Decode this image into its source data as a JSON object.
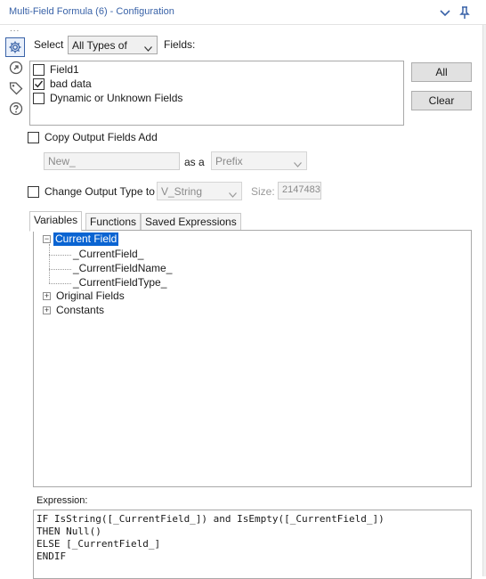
{
  "window": {
    "title": "Multi-Field Formula (6) - Configuration"
  },
  "select_row": {
    "select_label": "Select",
    "type_dropdown_value": "All Types of",
    "fields_label": "Fields:"
  },
  "fields": [
    {
      "label": "Field1",
      "checked": false
    },
    {
      "label": "bad data",
      "checked": true
    },
    {
      "label": "Dynamic or Unknown Fields",
      "checked": false
    }
  ],
  "buttons": {
    "all_label": "All",
    "clear_label": "Clear"
  },
  "copy_output": {
    "label": "Copy Output Fields Add",
    "checked": false,
    "affix_value": "New_",
    "as_a_label": "as a",
    "position_value": "Prefix"
  },
  "change_type": {
    "label": "Change Output Type to",
    "checked": false,
    "type_value": "V_String",
    "size_label": "Size:",
    "size_value": "2147483"
  },
  "tabs": [
    "Variables",
    "Functions",
    "Saved Expressions"
  ],
  "tree": {
    "current_field": "Current Field",
    "children": [
      "_CurrentField_",
      "_CurrentFieldName_",
      "_CurrentFieldType_"
    ],
    "original_fields": "Original Fields",
    "constants": "Constants"
  },
  "expression": {
    "label": "Expression:",
    "text": "IF IsString([_CurrentField_]) and IsEmpty([_CurrentField_])\nTHEN Null()\nELSE [_CurrentField_]\nENDIF"
  },
  "colors": {
    "accent": "#3a63a8",
    "selection": "#0a64d2"
  },
  "icons": [
    "gear-icon",
    "arrow-circle-icon",
    "tag-icon",
    "help-icon",
    "chevron-down-icon",
    "pin-icon"
  ]
}
